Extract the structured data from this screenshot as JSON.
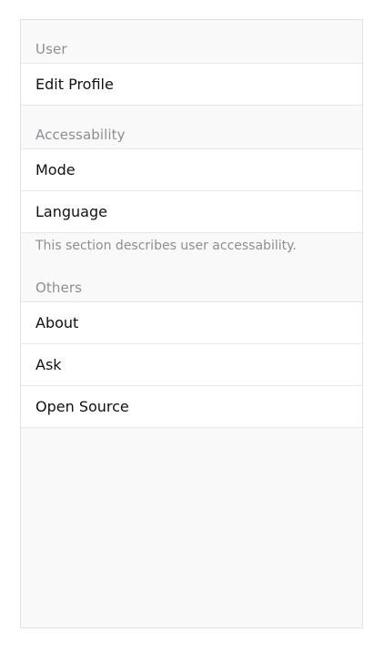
{
  "sections": [
    {
      "header": "User",
      "items": [
        {
          "label": "Edit Profile"
        }
      ]
    },
    {
      "header": "Accessability",
      "items": [
        {
          "label": "Mode"
        },
        {
          "label": "Language"
        }
      ],
      "footer": "This section describes user accessability."
    },
    {
      "header": "Others",
      "items": [
        {
          "label": "About"
        },
        {
          "label": "Ask"
        },
        {
          "label": "Open Source"
        }
      ]
    }
  ]
}
